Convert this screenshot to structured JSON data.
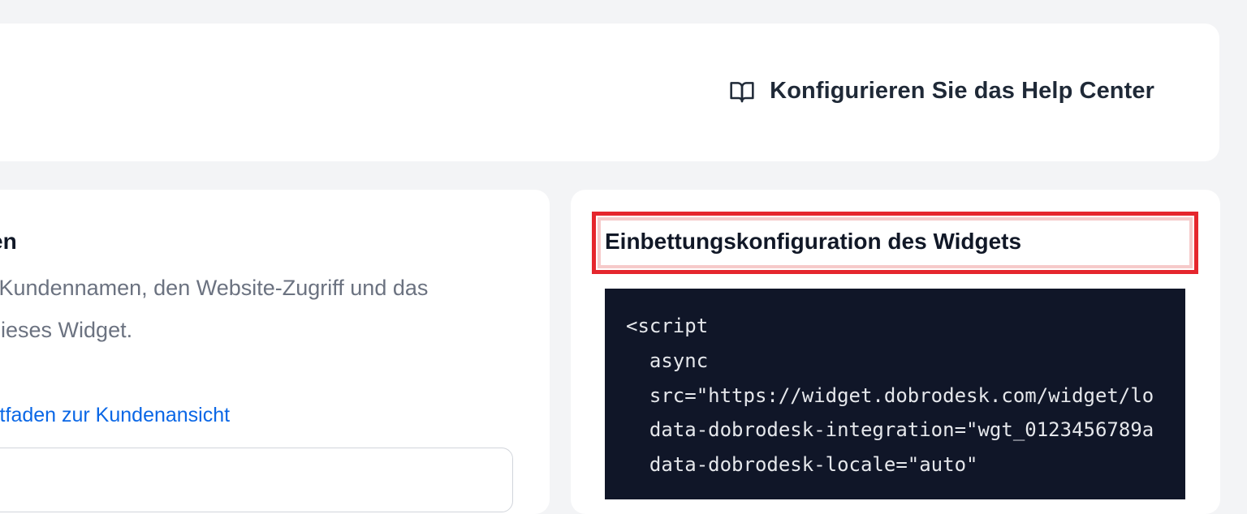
{
  "header": {
    "action_label": "Konfigurieren Sie das Help Center",
    "action_icon": "book-open-icon"
  },
  "left_panel": {
    "title": "en",
    "description_line1": "n Kundennamen, den Website-Zugriff und das",
    "description_line2": "dieses Widget.",
    "link_label": "itfaden zur Kundenansicht"
  },
  "right_panel": {
    "title": "Einbettungskonfiguration des Widgets",
    "code_lines": [
      "<script",
      "  async",
      "  src=\"https://widget.dobrodesk.com/widget/lo",
      "  data-dobrodesk-integration=\"wgt_0123456789a",
      "  data-dobrodesk-locale=\"auto\""
    ]
  },
  "colors": {
    "background": "#f3f4f6",
    "card": "#ffffff",
    "highlight_border": "#e5262d",
    "link": "#0a67e6",
    "code_background": "#101628"
  }
}
